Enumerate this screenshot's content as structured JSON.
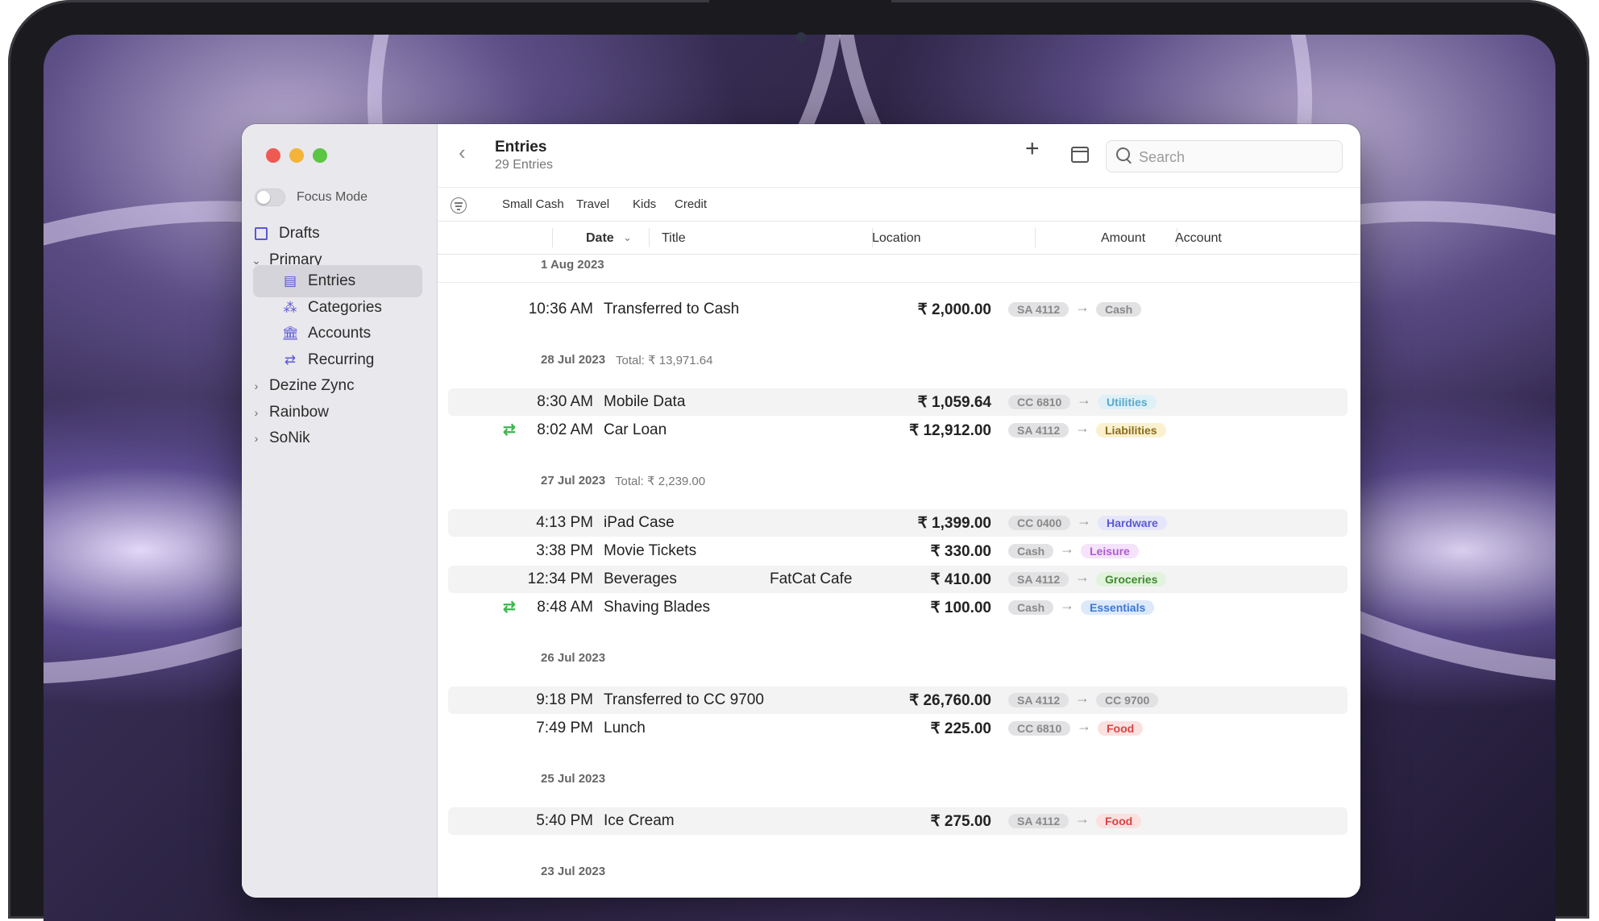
{
  "window": {
    "header": {
      "title": "Entries",
      "subtitle": "29 Entries",
      "search_placeholder": "Search"
    },
    "filters": [
      "Small Cash",
      "Travel",
      "Kids",
      "Credit"
    ],
    "columns": {
      "date": "Date",
      "title": "Title",
      "location": "Location",
      "amount": "Amount",
      "account": "Account"
    }
  },
  "sidebar": {
    "focus_label": "Focus Mode",
    "drafts": "Drafts",
    "primary": "Primary",
    "entries": "Entries",
    "categories": "Categories",
    "accounts": "Accounts",
    "recurring": "Recurring",
    "dezine": "Dezine Zync",
    "rainbow": "Rainbow",
    "sonik": "SoNik"
  },
  "groups": [
    {
      "date": "1 Aug 2023",
      "total": "",
      "entries": [
        {
          "time": "10:36 AM",
          "title": "Transferred to Cash",
          "location": "",
          "amount": "₹ 2,000.00",
          "from": "SA 4112",
          "to": "Cash",
          "to_color": "#e2e2e4",
          "to_text": "#888888",
          "recurring": false
        }
      ]
    },
    {
      "date": "28 Jul 2023",
      "total": "Total: ₹ 13,971.64",
      "entries": [
        {
          "time": "8:30 AM",
          "title": "Mobile Data",
          "location": "",
          "amount": "₹ 1,059.64",
          "from": "CC 6810",
          "to": "Utilities",
          "to_color": "#dff0f7",
          "to_text": "#5aa9c9",
          "recurring": false
        },
        {
          "time": "8:02 AM",
          "title": "Car Loan",
          "location": "",
          "amount": "₹ 12,912.00",
          "from": "SA 4112",
          "to": "Liabilities",
          "to_color": "#fbf1cf",
          "to_text": "#8a6d1a",
          "recurring": true
        }
      ]
    },
    {
      "date": "27 Jul 2023",
      "total": "Total: ₹ 2,239.00",
      "entries": [
        {
          "time": "4:13 PM",
          "title": "iPad Case",
          "location": "",
          "amount": "₹ 1,399.00",
          "from": "CC 0400",
          "to": "Hardware",
          "to_color": "#e6e6fb",
          "to_text": "#5a5ad6",
          "recurring": false
        },
        {
          "time": "3:38 PM",
          "title": "Movie Tickets",
          "location": "",
          "amount": "₹ 330.00",
          "from": "Cash",
          "to": "Leisure",
          "to_color": "#f4e3fb",
          "to_text": "#b259d6",
          "recurring": false
        },
        {
          "time": "12:34 PM",
          "title": "Beverages",
          "location": "FatCat Cafe",
          "amount": "₹ 410.00",
          "from": "SA 4112",
          "to": "Groceries",
          "to_color": "#e2f3dd",
          "to_text": "#3f8a2f",
          "recurring": false
        },
        {
          "time": "8:48 AM",
          "title": "Shaving Blades",
          "location": "",
          "amount": "₹ 100.00",
          "from": "Cash",
          "to": "Essentials",
          "to_color": "#dde9fb",
          "to_text": "#3b78d6",
          "recurring": true
        }
      ]
    },
    {
      "date": "26 Jul 2023",
      "total": "",
      "entries": [
        {
          "time": "9:18 PM",
          "title": "Transferred to CC 9700",
          "location": "",
          "amount": "₹ 26,760.00",
          "from": "SA 4112",
          "to": "CC 9700",
          "to_color": "#e2e2e4",
          "to_text": "#888888",
          "recurring": false
        },
        {
          "time": "7:49 PM",
          "title": "Lunch",
          "location": "",
          "amount": "₹ 225.00",
          "from": "CC 6810",
          "to": "Food",
          "to_color": "#fbe0e0",
          "to_text": "#d64545",
          "recurring": false
        }
      ]
    },
    {
      "date": "25 Jul 2023",
      "total": "",
      "entries": [
        {
          "time": "5:40 PM",
          "title": "Ice Cream",
          "location": "",
          "amount": "₹ 275.00",
          "from": "SA 4112",
          "to": "Food",
          "to_color": "#fbe0e0",
          "to_text": "#d64545",
          "recurring": false
        }
      ]
    },
    {
      "date": "23 Jul 2023",
      "total": "",
      "entries": []
    }
  ]
}
